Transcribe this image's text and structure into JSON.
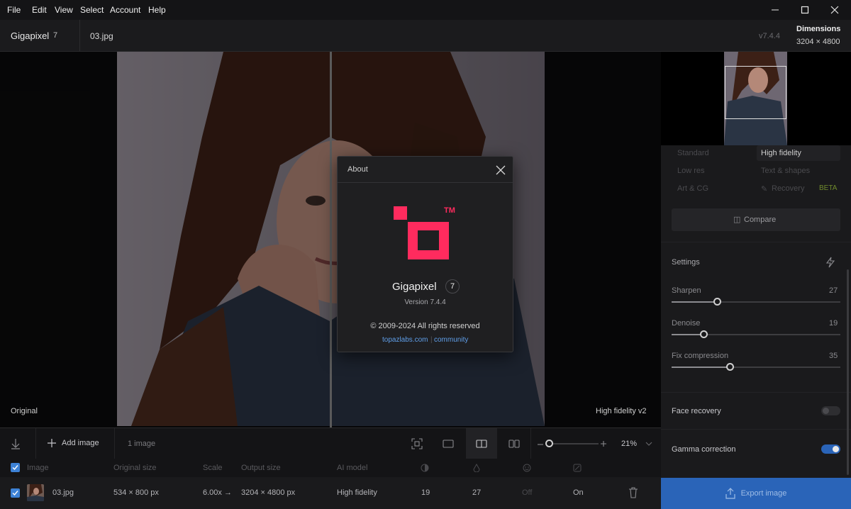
{
  "menu": [
    "File",
    "Edit",
    "View",
    "Select",
    "Account",
    "Help"
  ],
  "app": {
    "name": "Gigapixel",
    "major": "7",
    "file": "03.jpg",
    "version": "v7.4.4"
  },
  "dimensions": {
    "label": "Dimensions",
    "value": "3204 × 4800"
  },
  "preview": {
    "left_label": "Original",
    "right_label": "High fidelity v2"
  },
  "about": {
    "title": "About",
    "app_name": "Gigapixel",
    "badge": "7",
    "version": "Version 7.4.4",
    "copyright": "© 2009-2024 All rights reserved",
    "link1": "topazlabs.com",
    "link2": "community",
    "tm": "TM",
    "brand_color": "#ff2b5e"
  },
  "models": {
    "standard": "Standard",
    "high_fidelity": "High fidelity",
    "low_res": "Low res",
    "text_shapes": "Text & shapes",
    "art_cg": "Art & CG",
    "recovery": "Recovery",
    "beta": "BETA"
  },
  "compare_label": "Compare",
  "settings": {
    "title": "Settings",
    "sharpen": {
      "label": "Sharpen",
      "value": "27"
    },
    "denoise": {
      "label": "Denoise",
      "value": "19"
    },
    "fix_compression": {
      "label": "Fix compression",
      "value": "35"
    }
  },
  "face_recovery": {
    "label": "Face recovery",
    "on": false
  },
  "gamma_correction": {
    "label": "Gamma correction",
    "on": true
  },
  "toolbar": {
    "add_image": "Add image",
    "count": "1 image",
    "zoom": "21%"
  },
  "table": {
    "headers": [
      "Image",
      "Original size",
      "Scale",
      "Output size",
      "AI model"
    ],
    "row": {
      "name": "03.jpg",
      "original": "534 × 800 px",
      "scale": "6.00x →",
      "output": "3204 × 4800 px",
      "model": "High fidelity",
      "denoise": "19",
      "sharpen": "27",
      "face": "Off",
      "gamma": "On"
    }
  },
  "export_label": "Export image",
  "accent": "#2a64b8"
}
